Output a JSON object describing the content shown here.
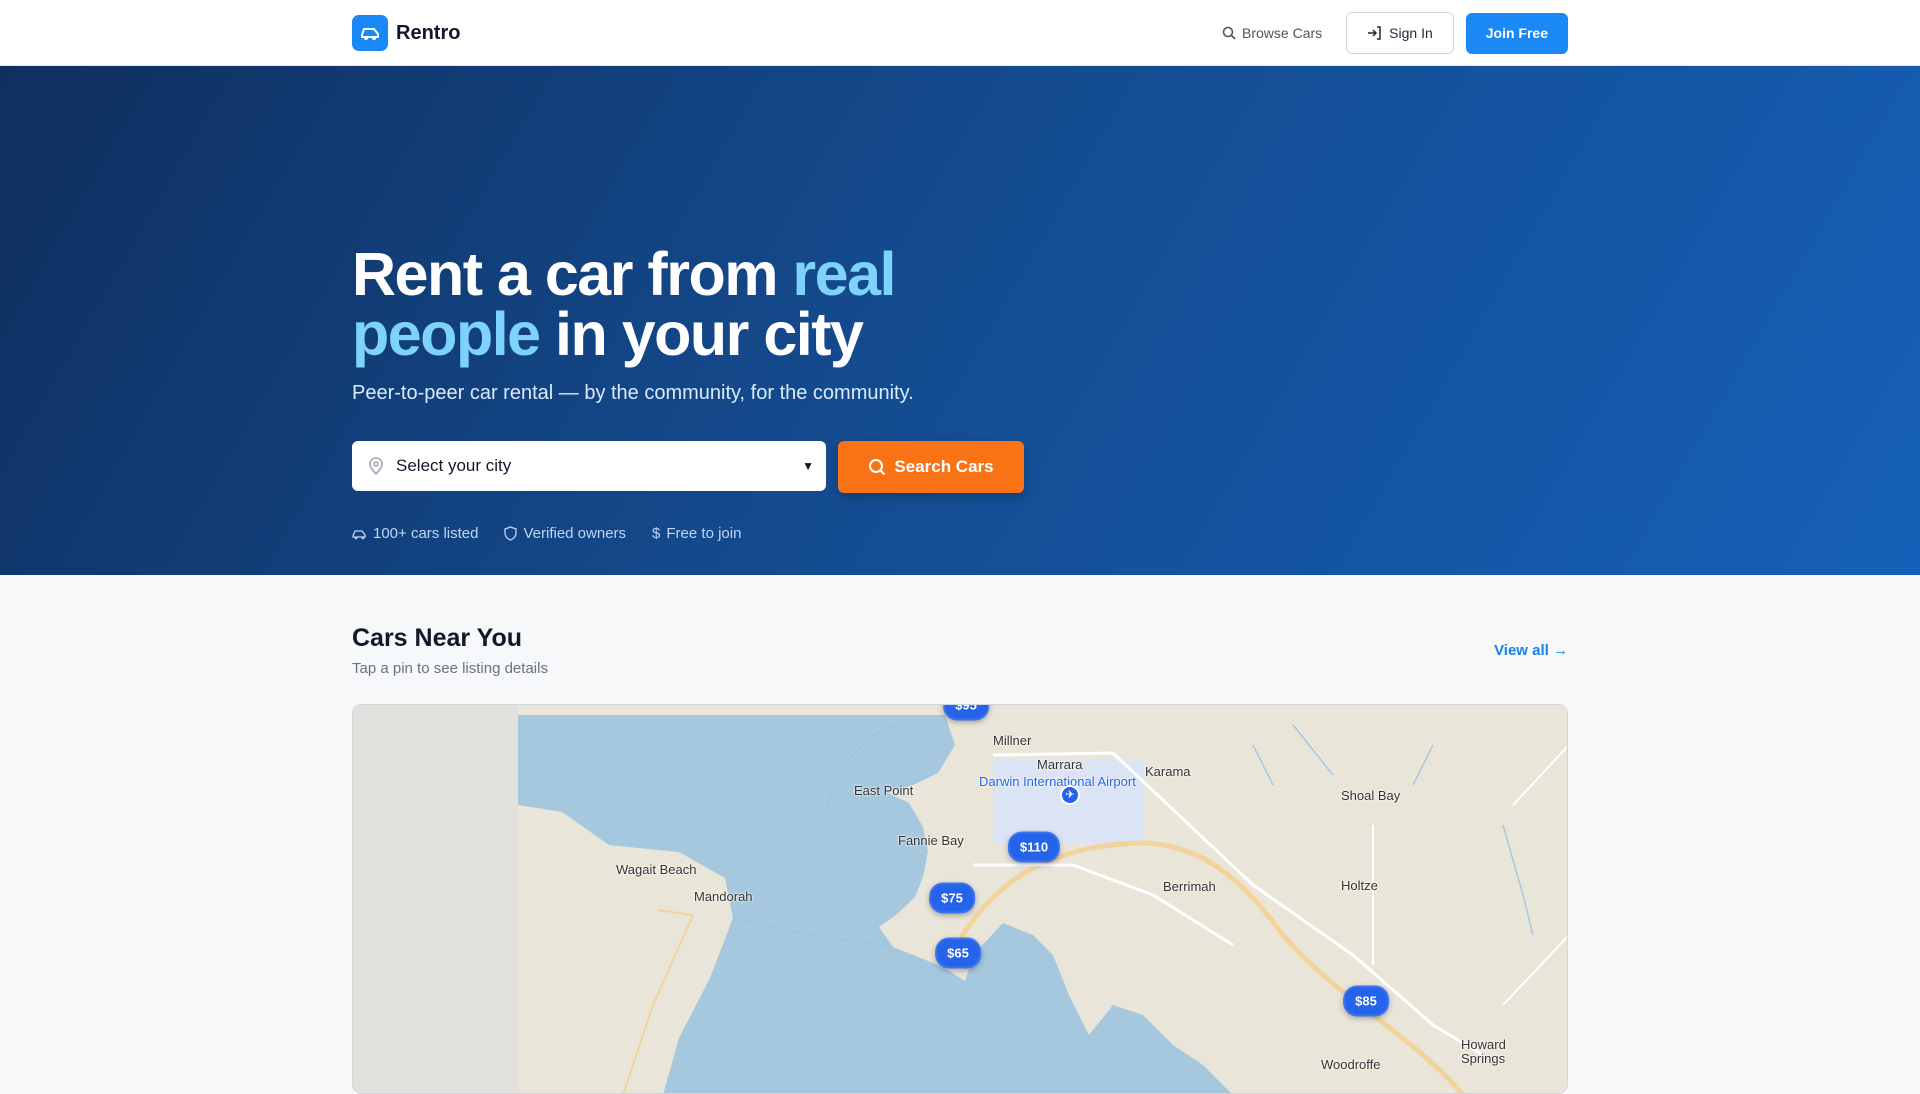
{
  "nav": {
    "brand": "Rentro",
    "browse": "Browse Cars",
    "signin": "Sign In",
    "join": "Join Free"
  },
  "hero": {
    "title_1": "Rent a car from ",
    "title_hl_1": "real",
    "title_hl_2": "people",
    "title_2": " in your city",
    "subtitle": "Peer-to-peer car rental — by the community, for the community.",
    "select_value": "Select your city",
    "search_label": "Search Cars",
    "features": [
      "100+ cars listed",
      "Verified owners",
      "Free to join"
    ]
  },
  "section": {
    "title": "Cars Near You",
    "subtitle": "Tap a pin to see listing details",
    "view_all": "View all"
  },
  "map": {
    "labels": {
      "millner": "Millner",
      "marrara": "Marrara",
      "karama": "Karama",
      "airport": "Darwin International Airport",
      "shoal_bay": "Shoal Bay",
      "east_point": "East Point",
      "fannie_bay": "Fannie Bay",
      "wagait": "Wagait Beach",
      "mandorah": "Mandorah",
      "berrimah": "Berrimah",
      "holtze": "Holtze",
      "woodroffe": "Woodroffe",
      "howard": "Howard Springs"
    },
    "pins": [
      "$95",
      "$110",
      "$75",
      "$65",
      "$85"
    ]
  },
  "colors": {
    "accent": "#1a88f5",
    "cta": "#f97316",
    "pin": "#2563eb"
  }
}
